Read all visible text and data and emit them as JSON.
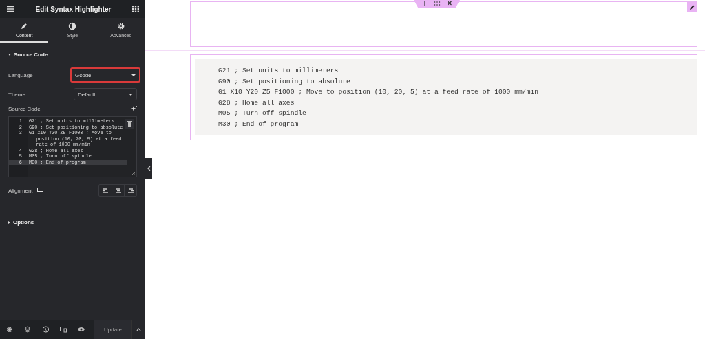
{
  "panel": {
    "title": "Edit Syntax Highlighter"
  },
  "tabs": [
    {
      "label": "Content",
      "selected": true
    },
    {
      "label": "Style",
      "selected": false
    },
    {
      "label": "Advanced",
      "selected": false
    }
  ],
  "sections": [
    {
      "title": "Source Code",
      "expanded": true,
      "controls": [
        {
          "kind": "select",
          "label": "Language",
          "value": "Gcode",
          "highlighted": true
        },
        {
          "kind": "select",
          "label": "Theme",
          "value": "Default",
          "highlighted": false
        },
        {
          "kind": "code",
          "label": "Source Code",
          "lines": [
            {
              "number": "1",
              "text": "G21 ; Set units to millimeters",
              "active": false
            },
            {
              "number": "2",
              "text": "G90 ; Set positioning to absolute",
              "active": false
            },
            {
              "number": "3",
              "text": "G1 X10 Y20 Z5 F1000 ; Move to position (10, 20, 5) at a feed rate of 1000 mm/min",
              "active": false
            },
            {
              "number": "4",
              "text": "G28 ; Home all axes",
              "active": false
            },
            {
              "number": "5",
              "text": "M05 ; Turn off spindle",
              "active": false
            },
            {
              "number": "6",
              "text": "M30 ; End of program",
              "active": true
            }
          ]
        },
        {
          "kind": "align",
          "label": "Alignment"
        }
      ]
    },
    {
      "title": "Options",
      "expanded": false
    }
  ],
  "footer": {
    "update": "Update"
  },
  "canvas": {
    "code": [
      "G21 ; Set units to millimeters",
      "G90 ; Set positioning to absolute",
      "G1 X10 Y20 Z5 F1000 ; Move to position (10, 20, 5) at a feed rate of 1000 mm/min",
      "G28 ; Home all axes",
      "M05 ; Turn off spindle",
      "M30 ; End of program"
    ]
  }
}
